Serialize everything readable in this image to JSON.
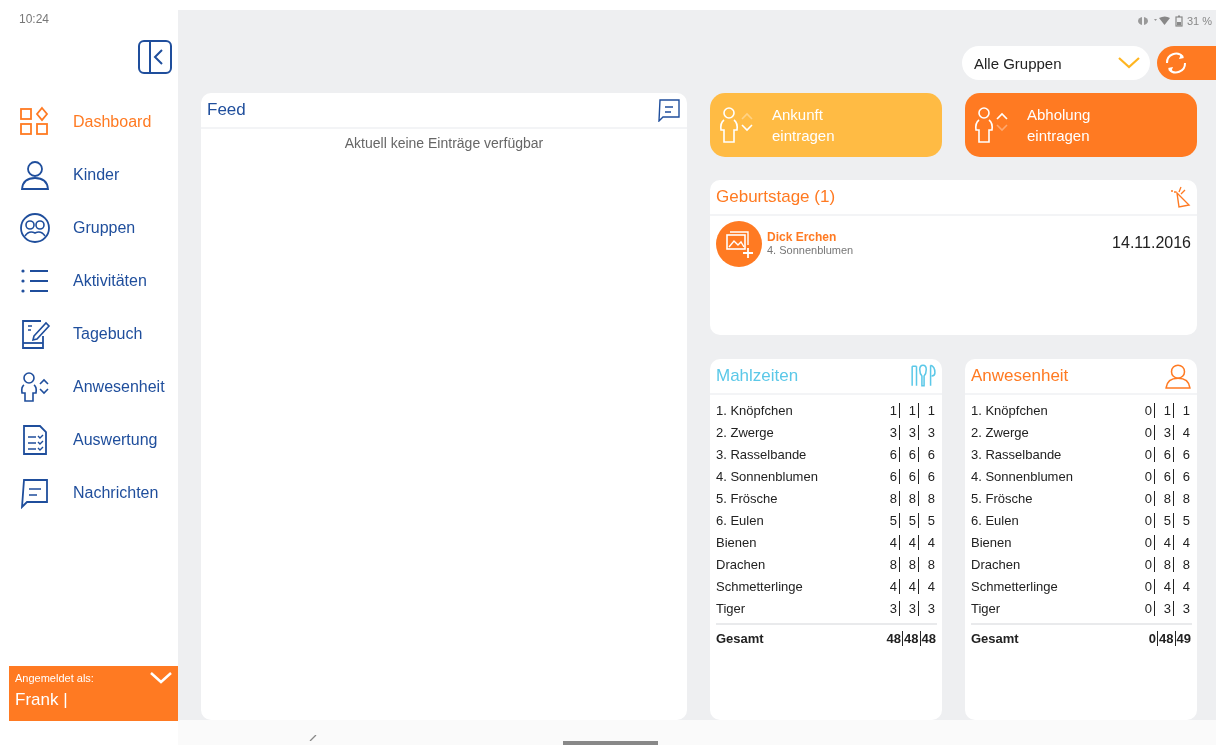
{
  "status_bar": {
    "time": "10:24",
    "battery": "31 %"
  },
  "sidebar": {
    "items": [
      {
        "label": "Dashboard",
        "selected": true
      },
      {
        "label": "Kinder",
        "selected": false
      },
      {
        "label": "Gruppen",
        "selected": false
      },
      {
        "label": "Aktivitäten",
        "selected": false
      },
      {
        "label": "Tagebuch",
        "selected": false
      },
      {
        "label": "Anwesenheit",
        "selected": false
      },
      {
        "label": "Auswertung",
        "selected": false
      },
      {
        "label": "Nachrichten",
        "selected": false
      }
    ],
    "login": {
      "label": "Angemeldet als:",
      "user": "Frank |"
    }
  },
  "toolbar": {
    "group_select": "Alle Gruppen"
  },
  "feed": {
    "title": "Feed",
    "empty_text": "Aktuell keine Einträge verfügbar"
  },
  "actions": [
    {
      "kind": "arrival",
      "label": "Ankunft eintragen"
    },
    {
      "kind": "pickup",
      "label": "Abholung eintragen"
    }
  ],
  "birthdays": {
    "title": "Geburtstage (1)",
    "entries": [
      {
        "name": "Dick Erchen",
        "group": "4. Sonnenblumen",
        "date": "14.11.2016"
      }
    ]
  },
  "stats": [
    {
      "kind": "meals",
      "title": "Mahlzeiten",
      "rows": [
        {
          "name": "1. Knöpfchen",
          "values": [
            "1",
            "1",
            "1"
          ]
        },
        {
          "name": "2. Zwerge",
          "values": [
            "3",
            "3",
            "3"
          ]
        },
        {
          "name": "3. Rasselbande",
          "values": [
            "6",
            "6",
            "6"
          ]
        },
        {
          "name": "4. Sonnenblumen",
          "values": [
            "6",
            "6",
            "6"
          ]
        },
        {
          "name": "5. Frösche",
          "values": [
            "8",
            "8",
            "8"
          ]
        },
        {
          "name": "6. Eulen",
          "values": [
            "5",
            "5",
            "5"
          ]
        },
        {
          "name": "Bienen",
          "values": [
            "4",
            "4",
            "4"
          ]
        },
        {
          "name": "Drachen",
          "values": [
            "8",
            "8",
            "8"
          ]
        },
        {
          "name": "Schmetterlinge",
          "values": [
            "4",
            "4",
            "4"
          ]
        },
        {
          "name": "Tiger",
          "values": [
            "3",
            "3",
            "3"
          ]
        }
      ],
      "total": {
        "name": "Gesamt",
        "values": [
          "48",
          "48",
          "48"
        ]
      }
    },
    {
      "kind": "attendance",
      "title": "Anwesenheit",
      "rows": [
        {
          "name": "1. Knöpfchen",
          "values": [
            "0",
            "1",
            "1"
          ]
        },
        {
          "name": "2. Zwerge",
          "values": [
            "0",
            "3",
            "4"
          ]
        },
        {
          "name": "3. Rasselbande",
          "values": [
            "0",
            "6",
            "6"
          ]
        },
        {
          "name": "4. Sonnenblumen",
          "values": [
            "0",
            "6",
            "6"
          ]
        },
        {
          "name": "5. Frösche",
          "values": [
            "0",
            "8",
            "8"
          ]
        },
        {
          "name": "6. Eulen",
          "values": [
            "0",
            "5",
            "5"
          ]
        },
        {
          "name": "Bienen",
          "values": [
            "0",
            "4",
            "4"
          ]
        },
        {
          "name": "Drachen",
          "values": [
            "0",
            "8",
            "8"
          ]
        },
        {
          "name": "Schmetterlinge",
          "values": [
            "0",
            "4",
            "4"
          ]
        },
        {
          "name": "Tiger",
          "values": [
            "0",
            "3",
            "3"
          ]
        }
      ],
      "total": {
        "name": "Gesamt",
        "values": [
          "0",
          "48",
          "49"
        ]
      }
    }
  ]
}
